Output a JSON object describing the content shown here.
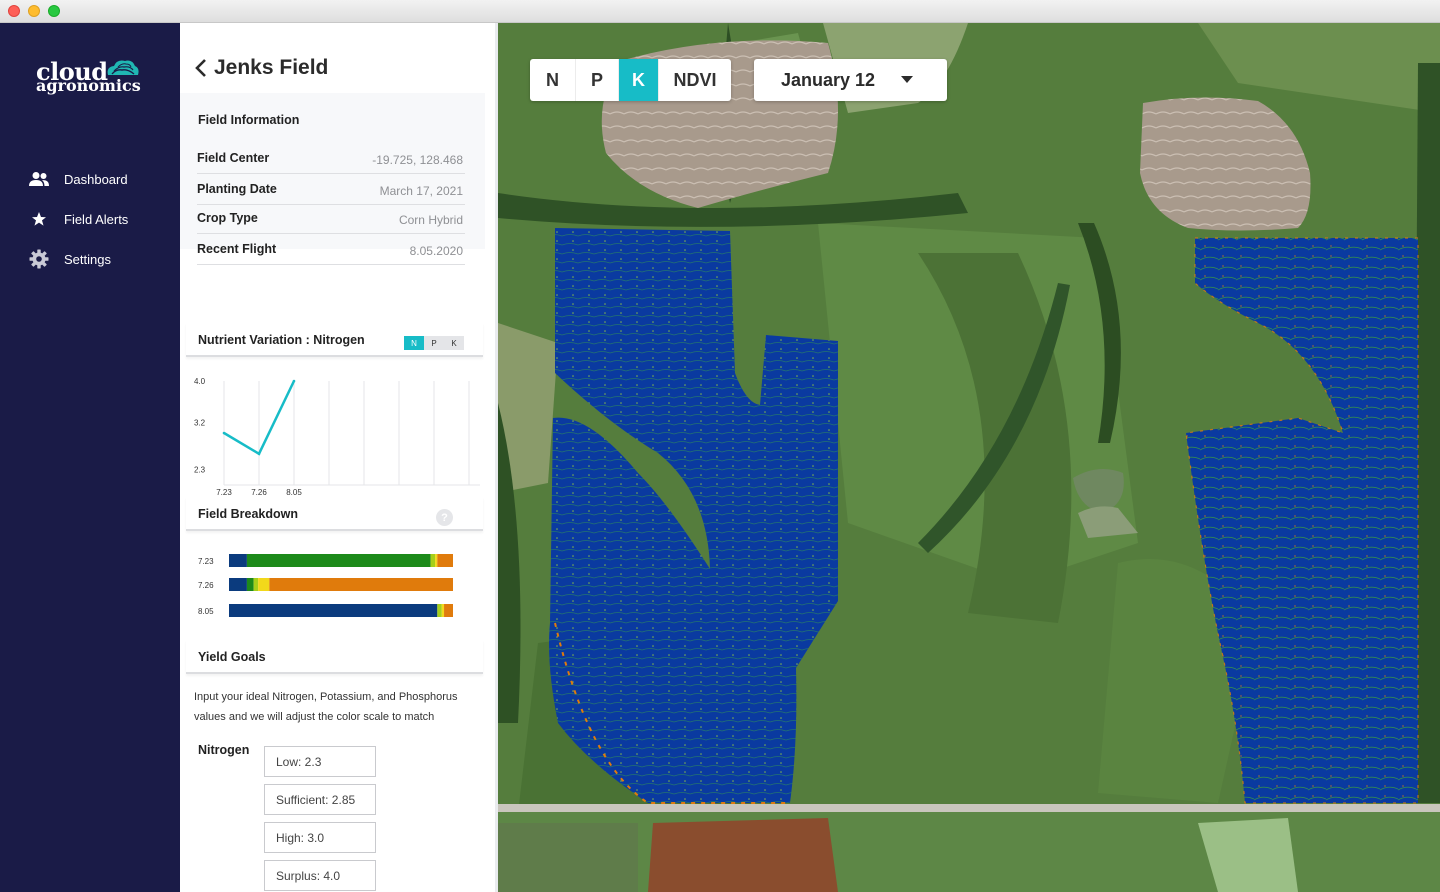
{
  "app": {
    "brand_line1": "cloud",
    "brand_line2": "agronomics"
  },
  "nav": {
    "items": [
      {
        "label": "Dashboard",
        "icon": "users-icon"
      },
      {
        "label": "Field Alerts",
        "icon": "star-icon"
      },
      {
        "label": "Settings",
        "icon": "gear-icon"
      }
    ]
  },
  "field": {
    "title": "Jenks Field",
    "info_heading": "Field Information",
    "rows": [
      {
        "key": "Field Center",
        "value": "-19.725, 128.468"
      },
      {
        "key": "Planting Date",
        "value": "March 17, 2021"
      },
      {
        "key": "Crop Type",
        "value": "Corn Hybrid"
      },
      {
        "key": "Recent Flight",
        "value": "8.05.2020"
      }
    ]
  },
  "nutrient": {
    "heading": "Nutrient Variation : Nitrogen",
    "toggle": [
      "N",
      "P",
      "K"
    ],
    "selected": "N"
  },
  "breakdown": {
    "heading": "Field Breakdown",
    "help_label": "?"
  },
  "chart_data": [
    {
      "type": "line",
      "title": "",
      "x": [
        "7.23",
        "7.26",
        "8.05"
      ],
      "series": [
        {
          "values": [
            3.0,
            2.6,
            4.0
          ],
          "color": "#17bcc7"
        }
      ],
      "yticks": [
        "4.0",
        "3.2",
        "2.3"
      ],
      "ylim": [
        2.0,
        4.0
      ],
      "grid": "vertical"
    },
    {
      "type": "bar",
      "orientation": "horizontal-stacked",
      "categories": [
        "7.23",
        "7.26",
        "8.05"
      ],
      "segment_colors": [
        "#0b3b7e",
        "#1d8a1a",
        "#a6cf1a",
        "#f2d81b",
        "#e07b0c"
      ],
      "values": [
        [
          8,
          82,
          2,
          1,
          7
        ],
        [
          8,
          3,
          2,
          5,
          82
        ],
        [
          93,
          0,
          2,
          1,
          4
        ]
      ],
      "units": "percent"
    }
  ],
  "yield": {
    "heading": "Yield Goals",
    "description": "Input your ideal Nitrogen, Potassium, and Phosphorus values and we will adjust the color scale to match",
    "nitrogen_label": "Nitrogen",
    "inputs": [
      "Low: 2.3",
      "Sufficient: 2.85",
      "High: 3.0",
      "Surplus: 4.0"
    ]
  },
  "map": {
    "layers": [
      "N",
      "P",
      "K",
      "NDVI"
    ],
    "selected_layer": "K",
    "date": "January 12"
  },
  "colors": {
    "nav_bg": "#1a1b47",
    "accent": "#17bcc7",
    "overlay_blue": "#0a3aa0"
  }
}
